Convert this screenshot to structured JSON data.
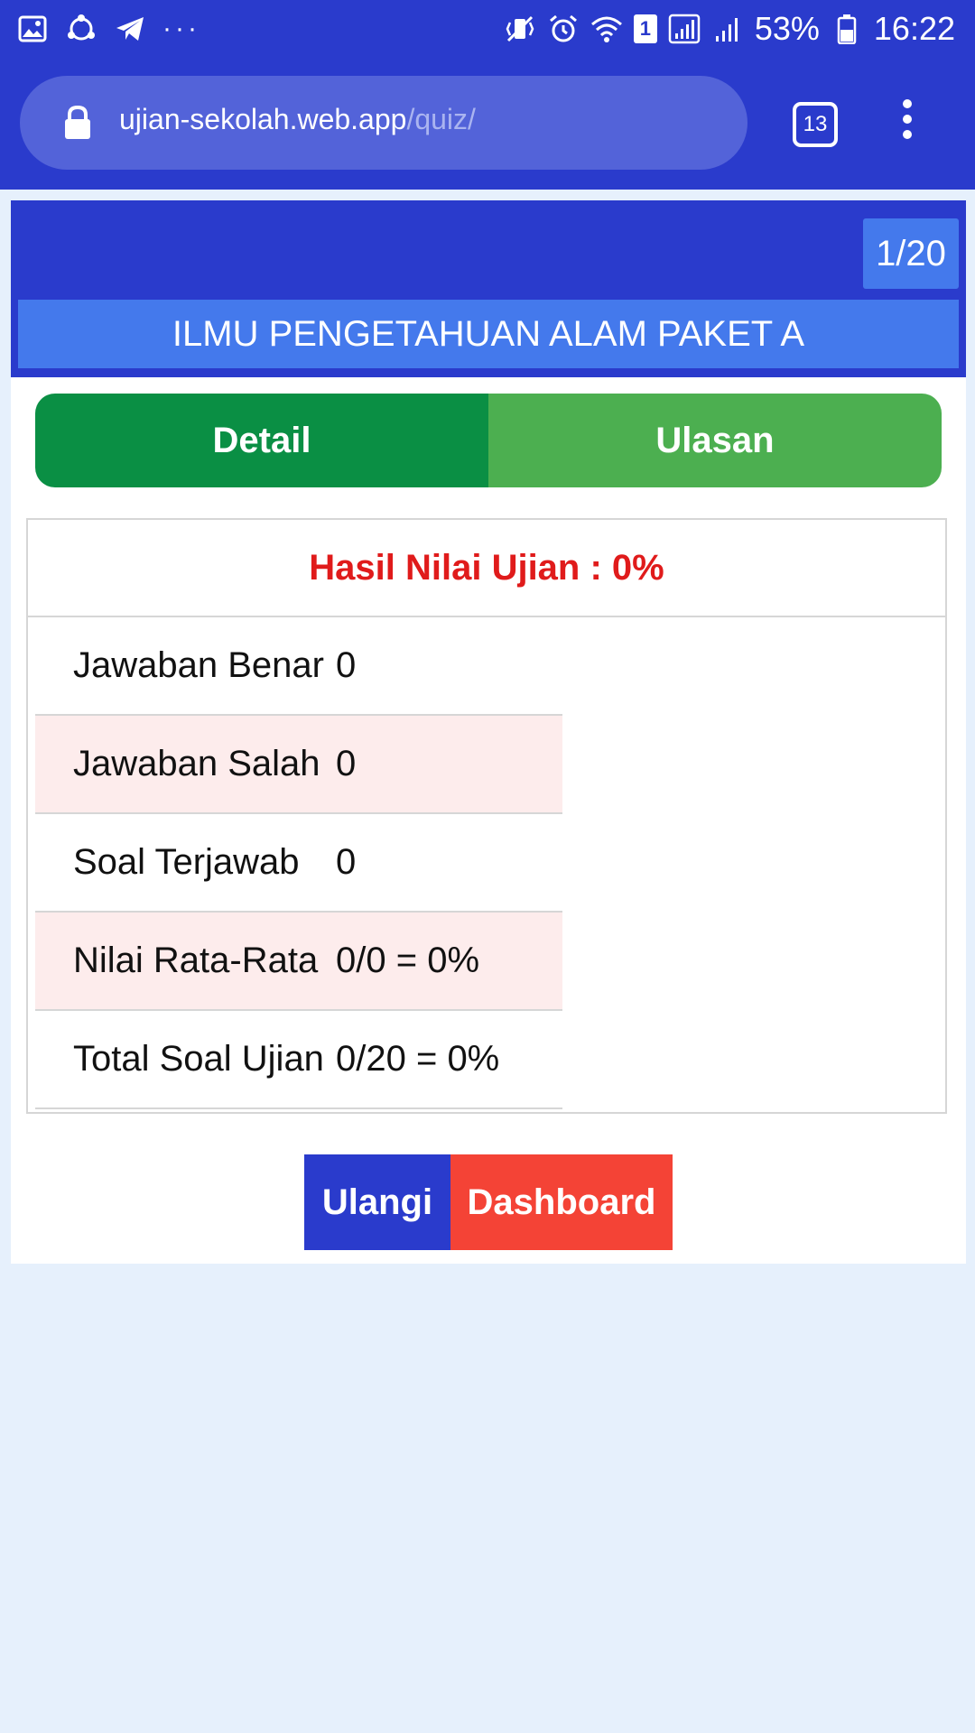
{
  "status_bar": {
    "battery": "53%",
    "time": "16:22",
    "sim_slot": "1",
    "overflow": "···",
    "left_icons": [
      "gallery-icon",
      "sync-icon",
      "telegram-icon"
    ],
    "right_icons": [
      "vibrate-icon",
      "alarm-icon",
      "wifi-icon",
      "signal-icon",
      "battery-icon"
    ]
  },
  "browser": {
    "url_host": "ujian-sekolah.web.app",
    "url_path": "/quiz/",
    "tab_count": "13"
  },
  "quiz": {
    "counter": "1/20",
    "subject": "ILMU PENGETAHUAN ALAM PAKET A",
    "tabs": [
      {
        "label": "Detail"
      },
      {
        "label": "Ulasan"
      }
    ],
    "result_title": "Hasil Nilai Ujian : 0%",
    "rows": [
      {
        "label": "Jawaban Benar",
        "value": "0"
      },
      {
        "label": "Jawaban Salah",
        "value": "0"
      },
      {
        "label": "Soal Terjawab",
        "value": "0"
      },
      {
        "label": "Nilai Rata-Rata",
        "value": "0/0 = 0%"
      },
      {
        "label": "Total Soal Ujian",
        "value": "0/20 = 0%"
      }
    ],
    "buttons": {
      "retry": "Ulangi",
      "dashboard": "Dashboard"
    }
  },
  "colors": {
    "primary_blue": "#2a3bcc",
    "light_blue": "#4479ec",
    "green_dark": "#0a8f44",
    "green_light": "#4caf50",
    "red_text": "#e01b1b",
    "red_button": "#f44336",
    "page_bg": "#e6f0fc"
  }
}
